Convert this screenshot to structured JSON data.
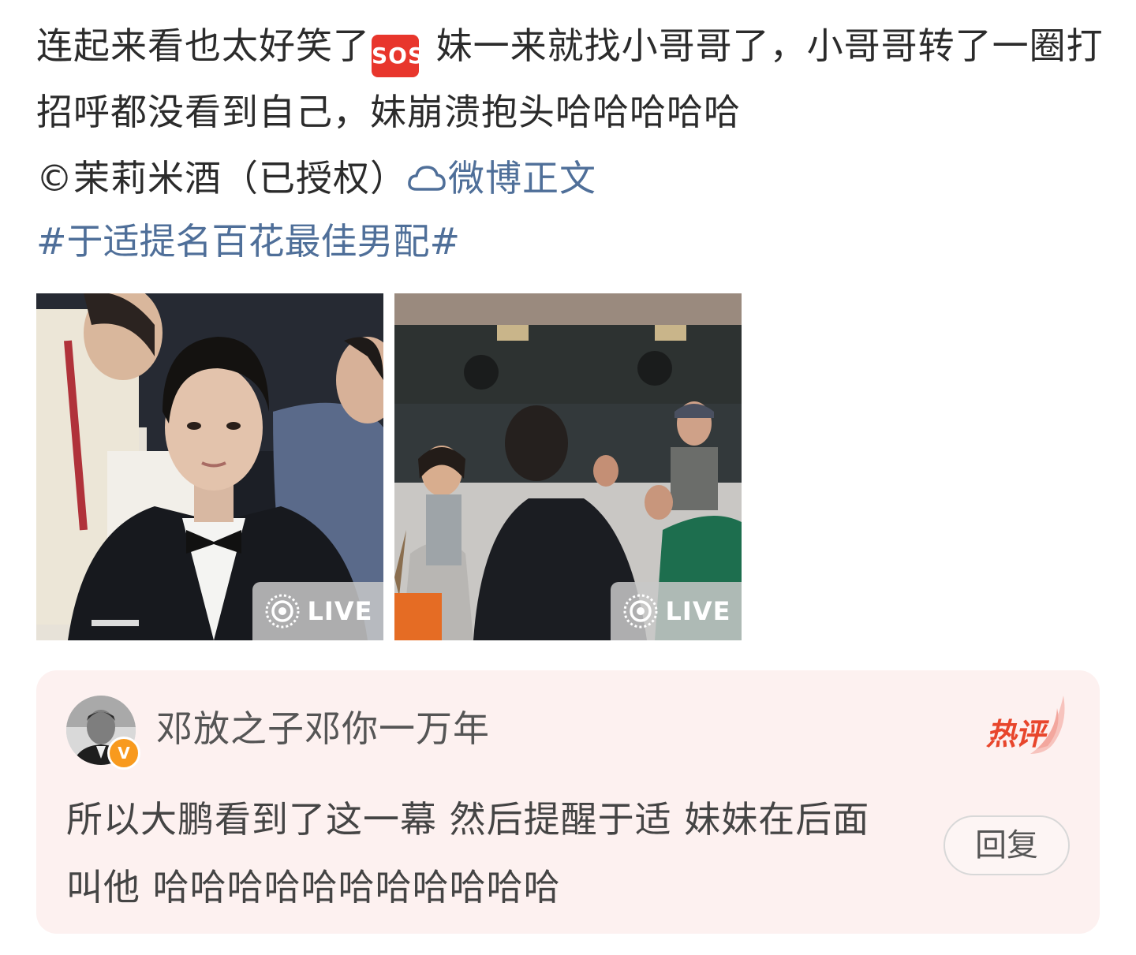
{
  "post": {
    "text_part1": "连起来看也太好笑了",
    "sos_label": "SOS",
    "text_part2": " 妹一来就找小哥哥了，小哥哥转了一圈打招呼都没看到自己，妹崩溃抱头哈哈哈哈哈",
    "copyright": "©茉莉米酒（已授权）",
    "weibo_link_label": "微博正文",
    "topic": "#于适提名百花最佳男配#"
  },
  "images": [
    {
      "badge": "LIVE",
      "icon": "live-photo-icon"
    },
    {
      "badge": "LIVE",
      "icon": "live-photo-icon"
    }
  ],
  "hot_comment": {
    "username": "邓放之子邓你一万年",
    "verified_mark": "V",
    "badge": "热评",
    "text": "所以大鹏看到了这一幕  然后提醒于适 妹妹在后面叫他 哈哈哈哈哈哈哈哈哈哈哈",
    "reply_label": "回复"
  },
  "colors": {
    "link": "#4f6f99",
    "card_bg": "#fdf1f0",
    "hot_red": "#e8462c",
    "verified_orange": "#f89a1e"
  }
}
